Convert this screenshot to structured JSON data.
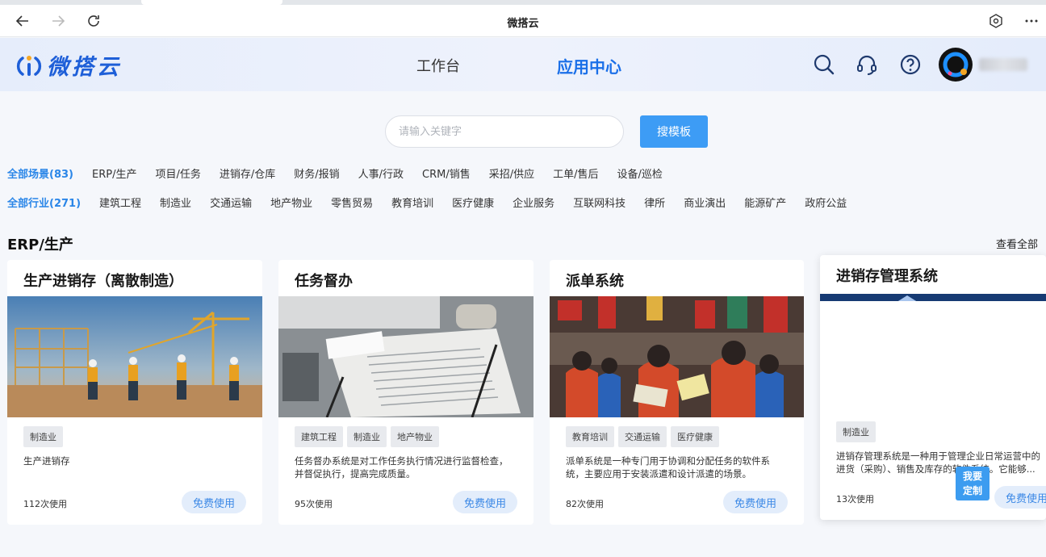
{
  "browser": {
    "title": "微搭云"
  },
  "header": {
    "logo_text": "微搭云",
    "tabs": [
      {
        "label": "工作台"
      },
      {
        "label": "应用中心"
      }
    ],
    "icons": [
      "search-icon",
      "headset-icon",
      "help-icon"
    ]
  },
  "search": {
    "placeholder": "请输入关键字",
    "button_label": "搜模板"
  },
  "filters": {
    "scenes": [
      "全部场景(83)",
      "ERP/生产",
      "项目/任务",
      "进销存/仓库",
      "财务/报销",
      "人事/行政",
      "CRM/销售",
      "采招/供应",
      "工单/售后",
      "设备/巡检"
    ],
    "industries": [
      "全部行业(271)",
      "建筑工程",
      "制造业",
      "交通运输",
      "地产物业",
      "零售贸易",
      "教育培训",
      "医疗健康",
      "企业服务",
      "互联网科技",
      "律所",
      "商业演出",
      "能源矿产",
      "政府公益"
    ]
  },
  "section": {
    "title": "ERP/生产",
    "see_all": "查看全部"
  },
  "cards": [
    {
      "title": "生产进销存（离散制造）",
      "tags": [
        "制造业"
      ],
      "desc": "生产进销存",
      "uses": "112次使用",
      "button": "免费使用"
    },
    {
      "title": "任务督办",
      "tags": [
        "建筑工程",
        "制造业",
        "地产物业"
      ],
      "desc": "任务督办系统是对工作任务执行情况进行监督检查，并督促执行，提高完成质量。",
      "uses": "95次使用",
      "button": "免费使用"
    },
    {
      "title": "派单系统",
      "tags": [
        "教育培训",
        "交通运输",
        "医疗健康"
      ],
      "desc": "派单系统是一种专门用于协调和分配任务的软件系统，主要应用于安装派遣和设计派遣的场景。",
      "uses": "82次使用",
      "button": "免费使用"
    },
    {
      "title": "进销存管理系统",
      "tags": [
        "制造业"
      ],
      "desc": "进销存管理系统是一种用于管理企业日常运营中的进货（采购）、销售及库存的软件系统。它能够...",
      "uses": "13次使用",
      "button": "免费使用"
    }
  ],
  "custom_badge": {
    "line1": "我要",
    "line2": "定制"
  },
  "colors": {
    "accent": "#1a6fe8",
    "button": "#3d9cf5",
    "filter_active": "#2a86e8"
  }
}
